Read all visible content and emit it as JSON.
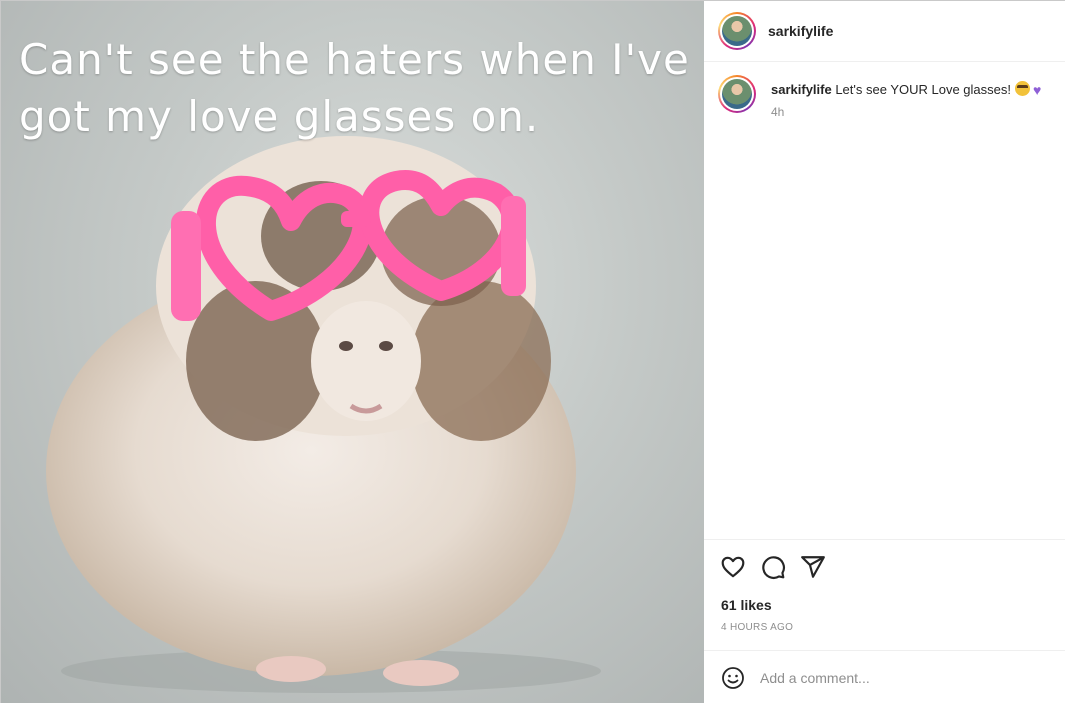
{
  "post": {
    "image_text": "Can't see the haters when I've got my love glasses on."
  },
  "header": {
    "username": "sarkifylife"
  },
  "comment": {
    "username": "sarkifylife",
    "text": "Let's see YOUR Love glasses!",
    "time": "4h"
  },
  "actions": {
    "likes": "61 likes",
    "posted_ago": "4 HOURS AGO"
  },
  "add_comment": {
    "placeholder": "Add a comment..."
  },
  "icons": [
    "heart-icon",
    "comment-icon",
    "share-icon",
    "emoji-icon"
  ],
  "colors": {
    "glasses": "#ff5fa8",
    "heart_emoji": "#8e5fd6",
    "secondary_text": "#8e8e8e"
  }
}
